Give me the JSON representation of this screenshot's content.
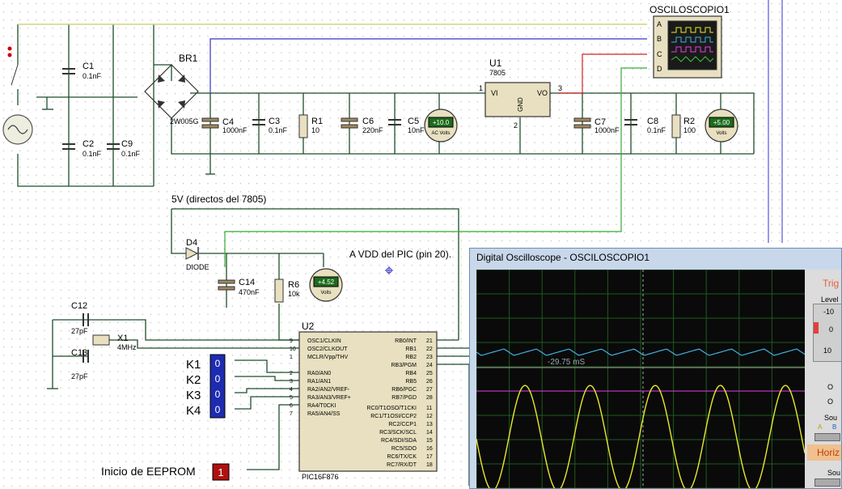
{
  "schematic": {
    "instrument_label": "OSCILOSCOPIO1",
    "channels": [
      "A",
      "B",
      "C",
      "D"
    ],
    "bridge": {
      "label": "BR1",
      "part": "2W005G"
    },
    "caps_input": [
      {
        "ref": "C1",
        "value": "0.1nF"
      },
      {
        "ref": "C2",
        "value": "0.1nF"
      },
      {
        "ref": "C9",
        "value": "0.1nF"
      }
    ],
    "caps_rail": [
      {
        "ref": "C4",
        "value": "1000nF"
      },
      {
        "ref": "C3",
        "value": "0.1nF"
      },
      {
        "ref": "C6",
        "value": "220nF"
      },
      {
        "ref": "C5",
        "value": "10nF"
      },
      {
        "ref": "C7",
        "value": "1000nF"
      },
      {
        "ref": "C8",
        "value": "0.1nF"
      }
    ],
    "resistors": [
      {
        "ref": "R1",
        "value": "10"
      },
      {
        "ref": "R2",
        "value": "100"
      },
      {
        "ref": "R6",
        "value": "10k"
      }
    ],
    "regulator": {
      "ref": "U1",
      "part": "7805",
      "pin_vi": "VI",
      "pin_vo": "VO",
      "pin_gnd": "GND",
      "pin1": "1",
      "pin2": "2",
      "pin3": "3"
    },
    "meters": [
      {
        "reading": "+10.0",
        "units": "AC Volts"
      },
      {
        "reading": "+5.00",
        "units": "Volts"
      },
      {
        "reading": "+4.52",
        "units": "Volts"
      }
    ],
    "note_5v": "5V (directos del 7805)",
    "diode": {
      "ref": "D4",
      "part": "DIODE"
    },
    "cap_c14": {
      "ref": "C14",
      "value": "470nF"
    },
    "note_avdd": "A VDD del PIC (pin 20).",
    "crystal": {
      "ref": "X1",
      "value": "4MHz"
    },
    "cap_c12": {
      "ref": "C12",
      "value": "27pF"
    },
    "cap_c13": {
      "ref": "C13",
      "value": "27pF"
    },
    "keys": [
      "K1",
      "K2",
      "K3",
      "K4"
    ],
    "logic_states": [
      "0",
      "0",
      "0",
      "0"
    ],
    "eeprom_label": "Inicio de EEPROM",
    "eeprom_value": "1",
    "mcu": {
      "ref": "U2",
      "part": "PIC16F876",
      "left_pins": [
        {
          "num": "9",
          "name": "OSC1/CLKIN"
        },
        {
          "num": "10",
          "name": "OSC2/CLKOUT"
        },
        {
          "num": "1",
          "name": "MCLR/Vpp/THV"
        },
        {
          "num": "2",
          "name": "RA0/AN0"
        },
        {
          "num": "3",
          "name": "RA1/AN1"
        },
        {
          "num": "4",
          "name": "RA2/AN2/VREF-"
        },
        {
          "num": "5",
          "name": "RA3/AN3/VREF+"
        },
        {
          "num": "6",
          "name": "RA4/T0CKI"
        },
        {
          "num": "7",
          "name": "RA5/AN4/SS"
        }
      ],
      "right_pins": [
        {
          "num": "21",
          "name": "RB0/INT"
        },
        {
          "num": "22",
          "name": "RB1"
        },
        {
          "num": "23",
          "name": "RB2"
        },
        {
          "num": "24",
          "name": "RB3/PGM"
        },
        {
          "num": "25",
          "name": "RB4"
        },
        {
          "num": "26",
          "name": "RB5"
        },
        {
          "num": "27",
          "name": "RB6/PGC"
        },
        {
          "num": "28",
          "name": "RB7/PGD"
        },
        {
          "num": "11",
          "name": "RC0/T1OSO/T1CKI"
        },
        {
          "num": "12",
          "name": "RC1/T1OSI/CCP2"
        },
        {
          "num": "13",
          "name": "RC2/CCP1"
        },
        {
          "num": "14",
          "name": "RC3/SCK/SCL"
        },
        {
          "num": "15",
          "name": "RC4/SDI/SDA"
        },
        {
          "num": "16",
          "name": "RC5/SDO"
        },
        {
          "num": "17",
          "name": "RC6/TX/CK"
        },
        {
          "num": "18",
          "name": "RC7/RX/DT"
        }
      ]
    }
  },
  "oscilloscope": {
    "title": "Digital Oscilloscope - OSCILOSCOPIO1",
    "cursor_readout": "-29.75 mS",
    "trigger_label": "Trig",
    "level_label": "Level",
    "knob_ticks": [
      "-10",
      "0",
      "10"
    ],
    "side_letters": [
      "O",
      "O",
      "Sou"
    ],
    "channel_letters": [
      "A",
      "B"
    ],
    "horizontal_label": "Horiz",
    "source_label": "Sou",
    "colors": {
      "ch_a": "#e8e830",
      "ch_b": "#40b0e0",
      "ch_c": "#e040e0",
      "grid": "#1e5a1e",
      "screen": "#0a0a0a"
    }
  }
}
